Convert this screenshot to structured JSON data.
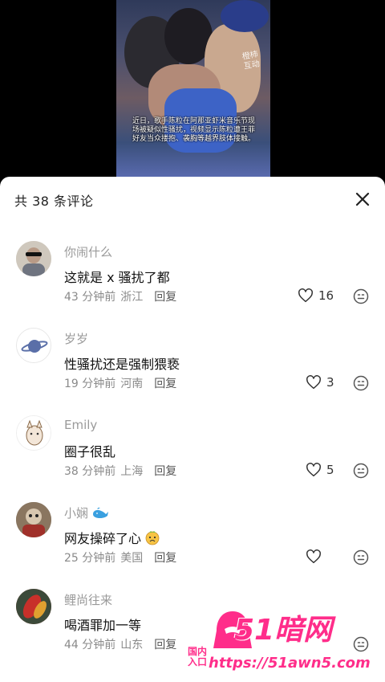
{
  "video": {
    "watermark": "橙柿\n互动",
    "caption": "近日，歌手陈粒在阿那亚虾米音乐节现场被疑似性骚扰，视频显示陈粒遭王菲好友当众搂抱、袭胸等越界肢体接触。"
  },
  "sheet": {
    "title": "共 38 条评论"
  },
  "comments": [
    {
      "name": "你闹什么",
      "text": "这就是 x 骚扰了都",
      "time": "43 分钟前",
      "location": "浙江",
      "reply": "回复",
      "likes": "16"
    },
    {
      "name": "岁岁",
      "text": "性骚扰还是强制猥亵",
      "time": "19 分钟前",
      "location": "河南",
      "reply": "回复",
      "likes": "3"
    },
    {
      "name": "Emily",
      "text": "圈子很乱",
      "time": "38 分钟前",
      "location": "上海",
      "reply": "回复",
      "likes": "5"
    },
    {
      "name": "小娴",
      "text": "网友操碎了心",
      "time": "25 分钟前",
      "location": "美国",
      "reply": "回复",
      "likes": ""
    },
    {
      "name": "鲤尚往来",
      "text": "喝酒罪加一等",
      "time": "44 分钟前",
      "location": "山东",
      "reply": "回复",
      "likes": ""
    }
  ],
  "ad": {
    "logo": "51暗网",
    "guonei": "国内\n入口",
    "url": "https://51awn5.com"
  },
  "colors": {
    "accent": "#ff2d8a",
    "text": "#111111",
    "muted": "#8a8a8a"
  }
}
